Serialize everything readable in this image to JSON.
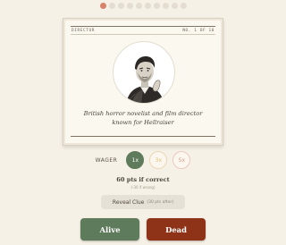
{
  "progress": {
    "total": 10,
    "current": 1
  },
  "card": {
    "category": "DIRECTOR",
    "counter": "NO. 1 OF 10",
    "clue": "British horror novelist and film director known for Hellraiser",
    "portrait_icon": "engraved-portrait"
  },
  "wager": {
    "label": "WAGER",
    "options": [
      {
        "label": "1x",
        "selected": true
      },
      {
        "label": "3x",
        "selected": false
      },
      {
        "label": "5x",
        "selected": false
      }
    ]
  },
  "points": {
    "text": "60 pts if correct",
    "subtext": "(-30 if wrong)"
  },
  "reveal": {
    "label": "Reveal Clue",
    "cost": "(30 pts after)"
  },
  "answers": {
    "alive": "Alive",
    "dead": "Dead"
  },
  "colors": {
    "background": "#f6f1e6",
    "alive": "#5e7b5b",
    "dead": "#8e3218",
    "progress_active": "#d9826a"
  }
}
